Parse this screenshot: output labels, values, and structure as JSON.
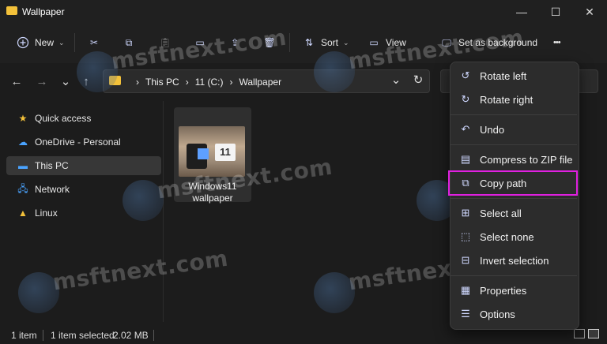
{
  "window": {
    "title": "Wallpaper",
    "minimize_glyph": "—",
    "maximize_glyph": "☐",
    "close_glyph": "✕"
  },
  "toolbar": {
    "new_label": "New",
    "sort_label": "Sort",
    "view_label": "View",
    "set_bg_label": "Set as background",
    "more_glyph": "•••"
  },
  "nav": {
    "back_glyph": "←",
    "forward_glyph": "→",
    "recent_glyph": "⌄",
    "up_glyph": "↑",
    "dropdown_glyph": "⌄",
    "refresh_glyph": "↻"
  },
  "address": {
    "crumbs": [
      "This PC",
      "11 (C:)",
      "Wallpaper"
    ],
    "chevron": "›"
  },
  "sidebar": {
    "items": [
      {
        "label": "Quick access",
        "icon": "star-icon"
      },
      {
        "label": "OneDrive - Personal",
        "icon": "cloud-icon"
      },
      {
        "label": "This PC",
        "icon": "monitor-icon"
      },
      {
        "label": "Network",
        "icon": "network-icon"
      },
      {
        "label": "Linux",
        "icon": "penguin-icon"
      }
    ]
  },
  "file": {
    "name_line1": "Windows11",
    "name_line2": "wallpaper",
    "thumb_badge": "11"
  },
  "status": {
    "count": "1 item",
    "selected": "1 item selected",
    "size": "2.02 MB"
  },
  "context_menu": {
    "items": [
      {
        "label": "Rotate left",
        "icon": "rotate-left-icon"
      },
      {
        "label": "Rotate right",
        "icon": "rotate-right-icon"
      },
      {
        "label": "Undo",
        "icon": "undo-icon"
      },
      {
        "label": "Compress to ZIP file",
        "icon": "zip-icon"
      },
      {
        "label": "Copy path",
        "icon": "copy-path-icon"
      },
      {
        "label": "Select all",
        "icon": "select-all-icon"
      },
      {
        "label": "Select none",
        "icon": "select-none-icon"
      },
      {
        "label": "Invert selection",
        "icon": "invert-selection-icon"
      },
      {
        "label": "Properties",
        "icon": "properties-icon"
      },
      {
        "label": "Options",
        "icon": "options-icon"
      }
    ]
  },
  "watermark": {
    "text": "msftnext.com"
  },
  "colors": {
    "highlight": "#e020e0",
    "folder": "#f3c13a",
    "accent": "#5ea0ff"
  }
}
